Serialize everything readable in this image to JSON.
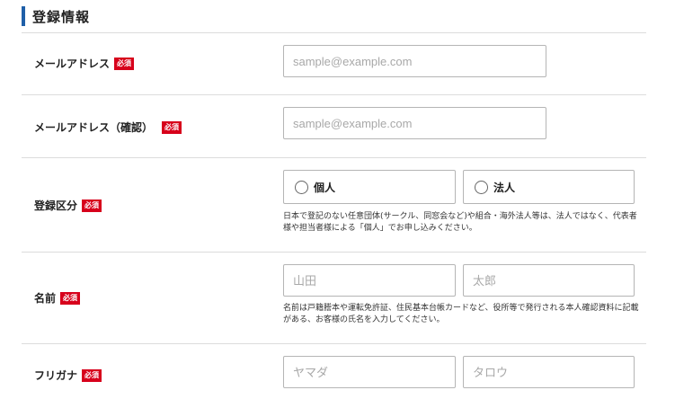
{
  "section": {
    "title": "登録情報"
  },
  "required_badge": "必須",
  "fields": {
    "email": {
      "label": "メールアドレス",
      "placeholder": "sample@example.com",
      "value": ""
    },
    "email_confirm": {
      "label": "メールアドレス（確認）",
      "placeholder": "sample@example.com",
      "value": ""
    },
    "registration_type": {
      "label": "登録区分",
      "options": [
        "個人",
        "法人"
      ],
      "selected": "",
      "note": "日本で登記のない任意団体(サークル、同窓会など)や組合・海外法人等は、法人ではなく、代表者様や担当者様による「個人」でお申し込みください。"
    },
    "name": {
      "label": "名前",
      "last_placeholder": "山田",
      "first_placeholder": "太郎",
      "note": "名前は戸籍謄本や運転免許証、住民基本台帳カードなど、役所等で発行される本人確認資料に記載がある、お客様の氏名を入力してください。"
    },
    "furigana": {
      "label": "フリガナ",
      "last_placeholder": "ヤマダ",
      "first_placeholder": "タロウ"
    }
  },
  "colors": {
    "accent": "#1f5fa8",
    "required": "#d7001b",
    "border": "#b5b5b5",
    "divider": "#dcdcdc"
  }
}
